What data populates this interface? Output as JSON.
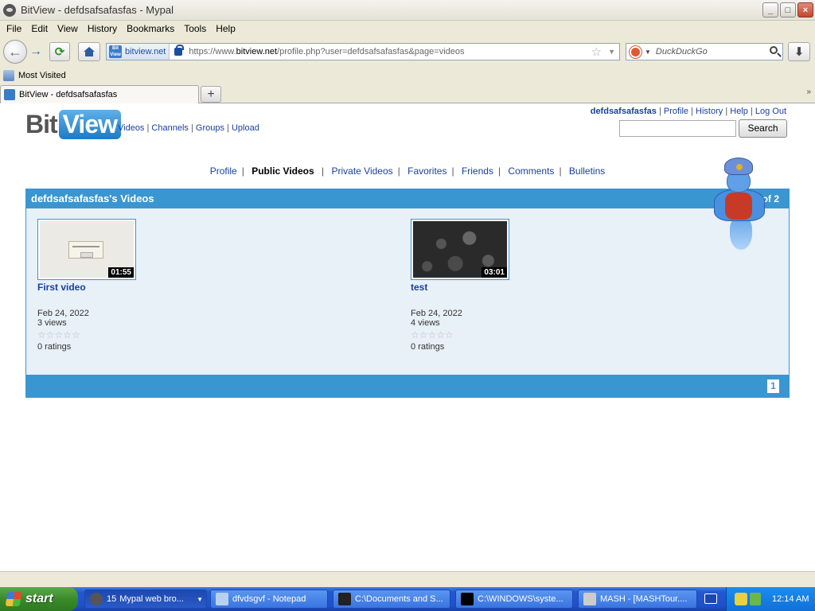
{
  "window": {
    "title": "BitView - defdsafsafasfas - Mypal",
    "controls": {
      "minimize": "_",
      "maximize": "□",
      "close": "×"
    }
  },
  "menu": [
    "File",
    "Edit",
    "View",
    "History",
    "Bookmarks",
    "Tools",
    "Help"
  ],
  "navbar": {
    "site_host": "bitview.net",
    "url_prefix": "https://www.",
    "url_domain": "bitview.net",
    "url_path": "/profile.php?user=defdsafsafasfas&page=videos",
    "search_placeholder": "DuckDuckGo",
    "favicon_text": "Bit View"
  },
  "bookmarks": {
    "most_visited": "Most Visited"
  },
  "tab": {
    "title": "BitView - defdsafsafasfas",
    "new_tab": "+",
    "tab_list": "»"
  },
  "site": {
    "logo_bit": "Bit",
    "logo_view": "View",
    "nav": [
      "Videos",
      "Channels",
      "Groups",
      "Upload"
    ],
    "user_nav": {
      "username": "defdsafsafasfas",
      "links": [
        "Profile",
        "History",
        "Help",
        "Log Out"
      ]
    },
    "search_button": "Search"
  },
  "profile_tabs": {
    "items": [
      "Profile",
      "Public Videos",
      "Private Videos",
      "Favorites",
      "Friends",
      "Comments",
      "Bulletins"
    ],
    "current": "Public Videos"
  },
  "videos_section": {
    "header": "defdsafsafasfas's Videos",
    "page_count": "of 2",
    "pager": "1",
    "videos": [
      {
        "title": "First video",
        "duration": "01:55",
        "date": "Feb 24, 2022",
        "views": "3 views",
        "stars": "☆☆☆☆☆",
        "ratings": "0 ratings"
      },
      {
        "title": "test",
        "duration": "03:01",
        "date": "Feb 24, 2022",
        "views": "4 views",
        "stars": "☆☆☆☆☆",
        "ratings": "0 ratings"
      }
    ]
  },
  "taskbar": {
    "start": "start",
    "tasks": [
      {
        "count": "15",
        "label": "Mypal web bro..."
      },
      {
        "label": "dfvdsgvf - Notepad"
      },
      {
        "label": "C:\\Documents and S..."
      },
      {
        "label": "C:\\WINDOWS\\syste..."
      },
      {
        "label": "MASH - [MASHTour...."
      }
    ],
    "clock": "12:14 AM"
  },
  "colors": {
    "accent": "#3a96d0",
    "link": "#1a3fa0",
    "taskbar": "#2458d0",
    "start": "#3a8a2a"
  }
}
